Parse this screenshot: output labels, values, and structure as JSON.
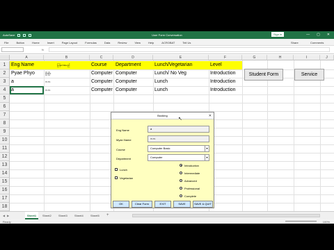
{
  "titlebar": {
    "title": "User Form Conversation",
    "sign_in": "Sign in",
    "min": "—",
    "max": "▢",
    "close": "✕"
  },
  "ribbon": {
    "tabs": [
      "File",
      "Button",
      "Home",
      "Insert",
      "Page Layout",
      "Formulas",
      "Data",
      "Review",
      "View",
      "Help",
      "ACROBAT",
      "Tell Us"
    ],
    "share": "Share",
    "comments": "Comments"
  },
  "formula_bar": {
    "fx": "fx"
  },
  "columns": [
    "A",
    "B",
    "C",
    "D",
    "E",
    "F",
    "G",
    "H",
    "I",
    "J"
  ],
  "rows": [
    "1",
    "2",
    "3",
    "4",
    "5",
    "6",
    "7",
    "8",
    "9",
    "10",
    "11",
    "12",
    "13",
    "14",
    "15",
    "16",
    "17",
    "18"
  ],
  "sheet": {
    "header": {
      "eng_name": "Eng Name",
      "myan_name": "မြန်မာအမည်",
      "course": "Course",
      "department": "Department",
      "lunch": "Lunch/Vegetarian",
      "level": "Level"
    },
    "row2": {
      "eng_name": "Pyae Phyo",
      "myan_name": "ဖြိုးဖြိုး",
      "course": "Computer",
      "department": "Computer",
      "lunch": "Lunch/ No Veg",
      "level": "Introduction"
    },
    "row3": {
      "eng_name": "a",
      "myan_name": "ကက",
      "course": "Computer",
      "department": "Computer",
      "lunch": "Lunch",
      "level": "Introduction"
    },
    "row4": {
      "eng_name": "a",
      "myan_name": "ကက",
      "course": "Computer",
      "department": "Computer",
      "lunch": "Lunch",
      "level": "Introduction"
    }
  },
  "buttons": {
    "student_form": "Student Form",
    "service": "Service"
  },
  "sheet_tabs": [
    "Sheet1",
    "Sheet2",
    "Sheet3",
    "Sheet4",
    "Sheet5",
    "+"
  ],
  "status": {
    "ready": "Ready",
    "zoom": "100%"
  },
  "dialog": {
    "title": "Booking",
    "close": "✕",
    "labels": {
      "eng_name": "Eng Name",
      "myan_name": "Myan Name",
      "course": "Course",
      "department": "Department"
    },
    "values": {
      "eng_name": "a",
      "myan_name": "ကက",
      "course": "Computer Basic",
      "department": "Computer"
    },
    "checkboxes": [
      "Lunch",
      "Vegetarian"
    ],
    "levels": [
      "Introduction",
      "Intermediate",
      "Advanced",
      "Professional",
      "Complete"
    ],
    "selected_level": "Introduction",
    "action_buttons": [
      "OK",
      "Clear Form",
      "EXIT",
      "SAVE",
      "SAVE & QUIT"
    ]
  }
}
